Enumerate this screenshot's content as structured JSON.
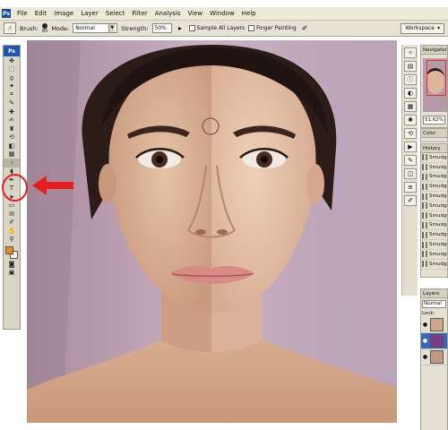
{
  "menubar": {
    "app_badge": "Ps",
    "items": [
      "File",
      "Edit",
      "Image",
      "Layer",
      "Select",
      "Filter",
      "Analysis",
      "View",
      "Window",
      "Help"
    ]
  },
  "options_bar": {
    "brush_label": "Brush:",
    "brush_size": "85",
    "mode_label": "Mode:",
    "mode_value": "Normal",
    "strength_label": "Strength:",
    "strength_value": "50%",
    "sample_all_layers": "Sample All Layers",
    "finger_painting": "Finger Painting",
    "workspace_label": "Workspace"
  },
  "tool_panel": {
    "badge": "Ps",
    "tools": [
      {
        "icon": "move-icon",
        "glyph": "✥"
      },
      {
        "icon": "marquee-icon",
        "glyph": "⬚"
      },
      {
        "icon": "lasso-icon",
        "glyph": "ϙ"
      },
      {
        "icon": "magic-wand-icon",
        "glyph": "✦"
      },
      {
        "icon": "crop-icon",
        "glyph": "⌗"
      },
      {
        "icon": "slice-icon",
        "glyph": "✎"
      },
      {
        "icon": "healing-brush-icon",
        "glyph": "✚"
      },
      {
        "icon": "brush-icon",
        "glyph": "✍"
      },
      {
        "icon": "clone-stamp-icon",
        "glyph": "♜"
      },
      {
        "icon": "history-brush-icon",
        "glyph": "⟲"
      },
      {
        "icon": "eraser-icon",
        "glyph": "◧"
      },
      {
        "icon": "gradient-icon",
        "glyph": "▦"
      },
      {
        "icon": "smudge-icon",
        "glyph": "☝"
      },
      {
        "icon": "dodge-icon",
        "glyph": "◖"
      },
      {
        "icon": "pen-icon",
        "glyph": "✒"
      },
      {
        "icon": "type-icon",
        "glyph": "T"
      },
      {
        "icon": "path-selection-icon",
        "glyph": "➤"
      },
      {
        "icon": "shape-icon",
        "glyph": "▭"
      },
      {
        "icon": "notes-icon",
        "glyph": "✉"
      },
      {
        "icon": "eyedropper-icon",
        "glyph": "✐"
      },
      {
        "icon": "hand-icon",
        "glyph": "✋"
      },
      {
        "icon": "zoom-icon",
        "glyph": "⚲"
      }
    ],
    "selected_index": 12,
    "foreground_color": "#e88a20",
    "background_color": "#f3f0e6"
  },
  "icon_strip": {
    "icons": [
      "navigator-icon",
      "histogram-icon",
      "info-icon",
      "color-icon",
      "swatches-icon",
      "styles-icon",
      "history-icon",
      "actions-icon",
      "tool-presets-icon",
      "layers-icon",
      "channels-icon",
      "paths-icon"
    ]
  },
  "palettes": {
    "navigator": {
      "tab": "Navigator",
      "zoom": "51.62%"
    },
    "color": {
      "tab": "Color"
    },
    "history": {
      "tab": "History",
      "rows": [
        "Smudge",
        "Smudge",
        "Smudge",
        "Smudge",
        "Smudge",
        "Smudge",
        "Smudge",
        "Smudge",
        "Smudge",
        "Smudge",
        "Smudge",
        "Smudge"
      ]
    },
    "layers": {
      "tab": "Layers",
      "mode": "Normal",
      "lock": "Lock:"
    }
  },
  "annotation": {
    "color": "#e51f1f"
  },
  "colors": {
    "menubar": "#ece9d8",
    "panel": "#d8d5c7",
    "accent": "#1f57b0"
  }
}
